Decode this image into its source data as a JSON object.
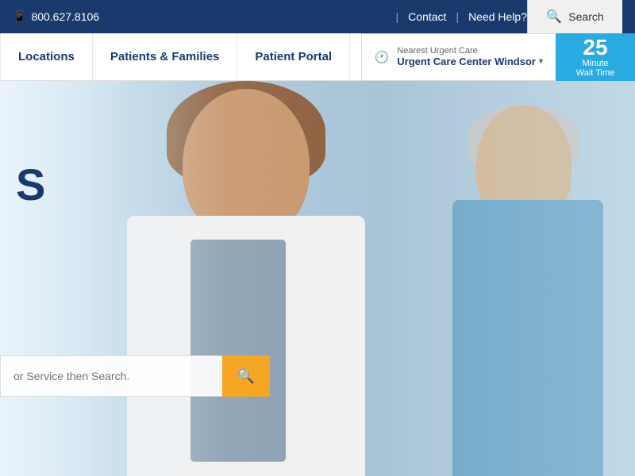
{
  "topbar": {
    "phone": "800.627.8106",
    "contact": "Contact",
    "need_help": "Need Help?",
    "search_label": "Search"
  },
  "nav": {
    "links": [
      {
        "label": "Locations",
        "id": "locations"
      },
      {
        "label": "Patients & Families",
        "id": "patients-families"
      },
      {
        "label": "Patient Portal",
        "id": "patient-portal"
      }
    ]
  },
  "urgent_care": {
    "nearest_label": "Nearest Urgent Care",
    "location_name": "Urgent Care Center Windsor",
    "wait_number": "25",
    "wait_label": "Minute\nWait Time"
  },
  "hero": {
    "title": "S",
    "search_placeholder": "or Service then Search.",
    "search_button_label": "Search"
  },
  "colors": {
    "brand_dark": "#1a3a6e",
    "brand_light": "#29aae1",
    "accent_orange": "#f5a623"
  }
}
